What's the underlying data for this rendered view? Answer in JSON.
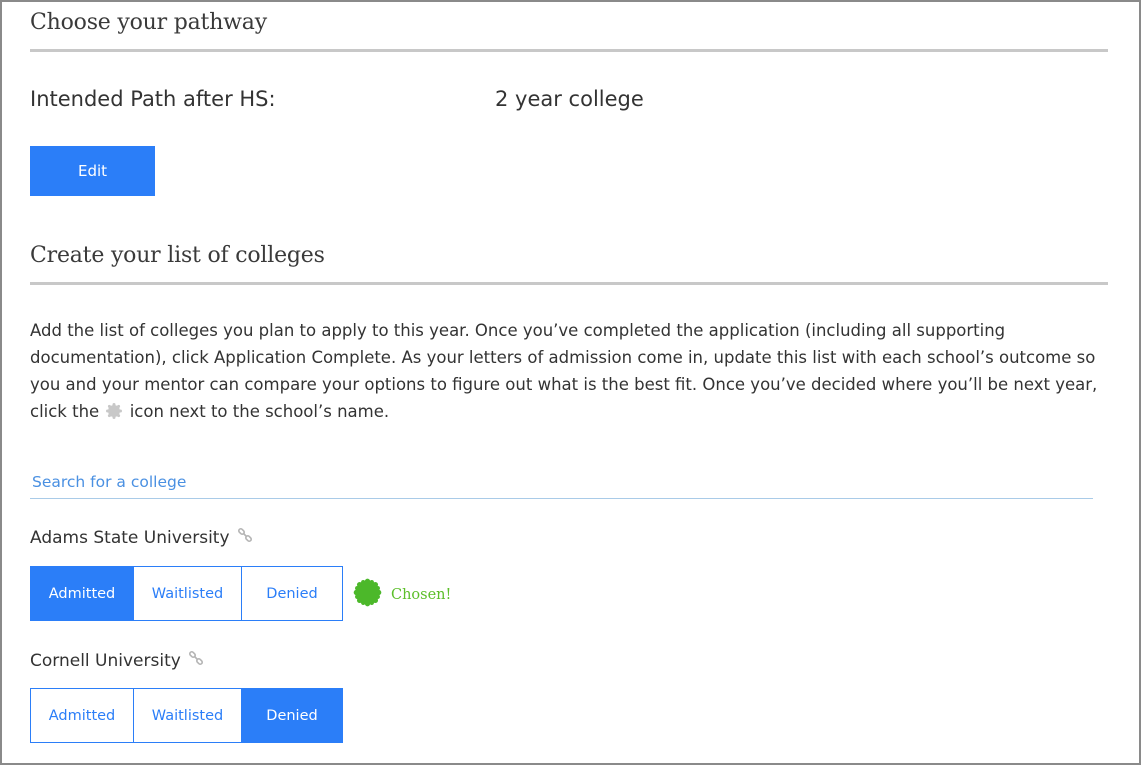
{
  "pathway": {
    "title": "Choose your pathway",
    "intended_label": "Intended Path after HS:",
    "intended_value": "2 year college",
    "edit_label": "Edit"
  },
  "colleges": {
    "title": "Create your list of colleges",
    "instructions_before": "Add the list of colleges you plan to apply to this year. Once you’ve completed the application (including all supporting documentation), click Application Complete. As your letters of admission come in, update this list with each school’s outcome so you and your mentor can compare your options to figure out what is the best fit. Once you’ve decided where you’ll be next year, click the",
    "instructions_after": "icon next to the school’s name.",
    "inline_icon": "gear-badge-icon",
    "search_placeholder": "Search for a college",
    "list": [
      {
        "name": "Adams State University",
        "options": [
          "Admitted",
          "Waitlisted",
          "Denied"
        ],
        "selected": "Admitted",
        "chosen": true,
        "chosen_label": "Chosen!"
      },
      {
        "name": "Cornell University",
        "options": [
          "Admitted",
          "Waitlisted",
          "Denied"
        ],
        "selected": "Denied",
        "chosen": false
      }
    ]
  },
  "colors": {
    "accent": "#2b7ef8",
    "chosen": "#5cbf2a",
    "rule": "#c8c8c8",
    "placeholder": "#4a90e2"
  }
}
